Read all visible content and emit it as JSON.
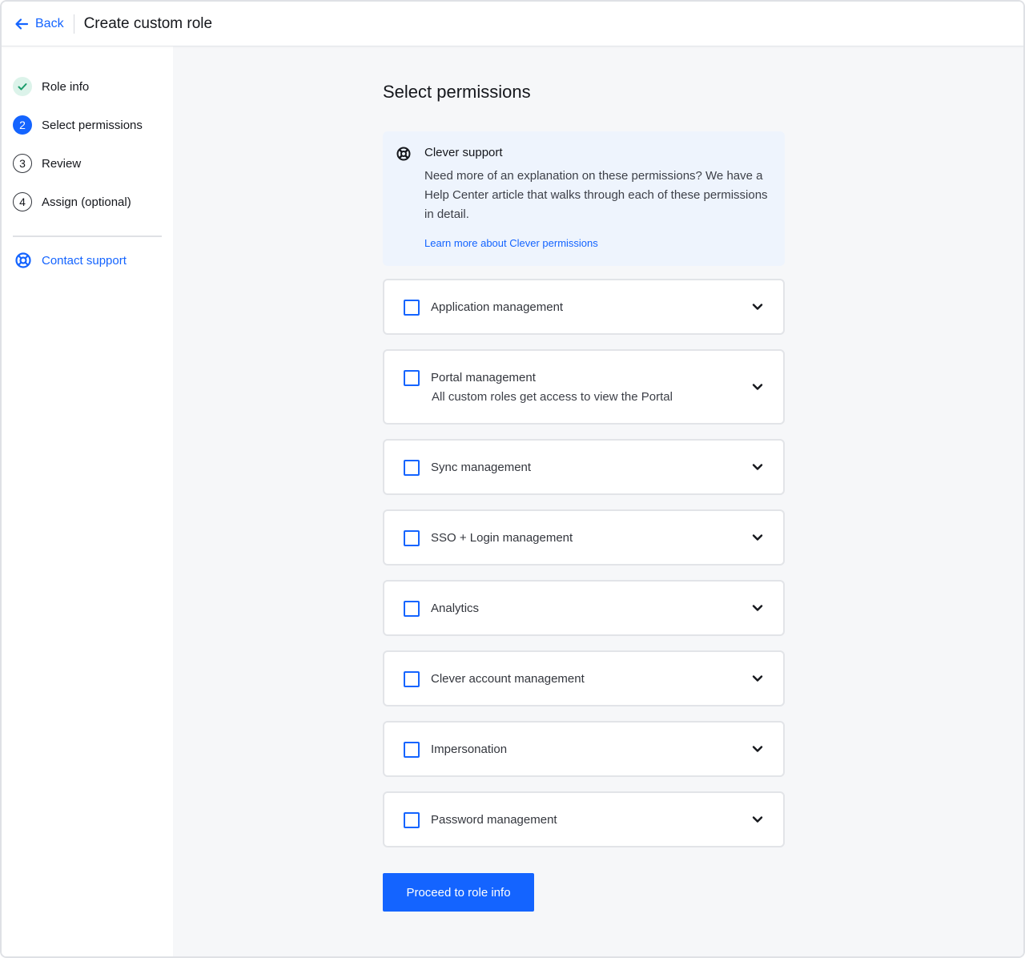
{
  "header": {
    "back_label": "Back",
    "title": "Create custom role"
  },
  "sidebar": {
    "steps": [
      {
        "marker": "",
        "label": "Role info",
        "state": "done"
      },
      {
        "marker": "2",
        "label": "Select permissions",
        "state": "active"
      },
      {
        "marker": "3",
        "label": "Review",
        "state": "todo"
      },
      {
        "marker": "4",
        "label": "Assign (optional)",
        "state": "todo"
      }
    ],
    "contact_label": "Contact support"
  },
  "main": {
    "section_title": "Select permissions",
    "info": {
      "title": "Clever support",
      "body": "Need more of an explanation on these permissions? We have a Help Center article that walks through each of these permissions in detail.",
      "link": "Learn more about Clever permissions"
    },
    "permissions": [
      {
        "label": "Application management",
        "checked": false
      },
      {
        "label": "Portal management",
        "description": "All custom roles get access to view the Portal",
        "checked": false
      },
      {
        "label": "Sync management",
        "checked": false
      },
      {
        "label": "SSO + Login management",
        "checked": false
      },
      {
        "label": "Analytics",
        "checked": false
      },
      {
        "label": "Clever account management",
        "checked": false
      },
      {
        "label": "Impersonation",
        "checked": false
      },
      {
        "label": "Password management",
        "checked": false
      }
    ],
    "proceed_label": "Proceed to role info"
  },
  "colors": {
    "accent": "#1464ff",
    "done_step_bg": "#dcf3ea",
    "done_check": "#1a9c6b",
    "info_bg": "#eef4fd",
    "page_bg": "#f6f7f9"
  },
  "icons": {
    "back": "arrow-left-icon",
    "done_step": "check-icon",
    "contact": "lifebuoy-icon",
    "info": "lifebuoy-icon",
    "expand": "chevron-down-icon"
  }
}
